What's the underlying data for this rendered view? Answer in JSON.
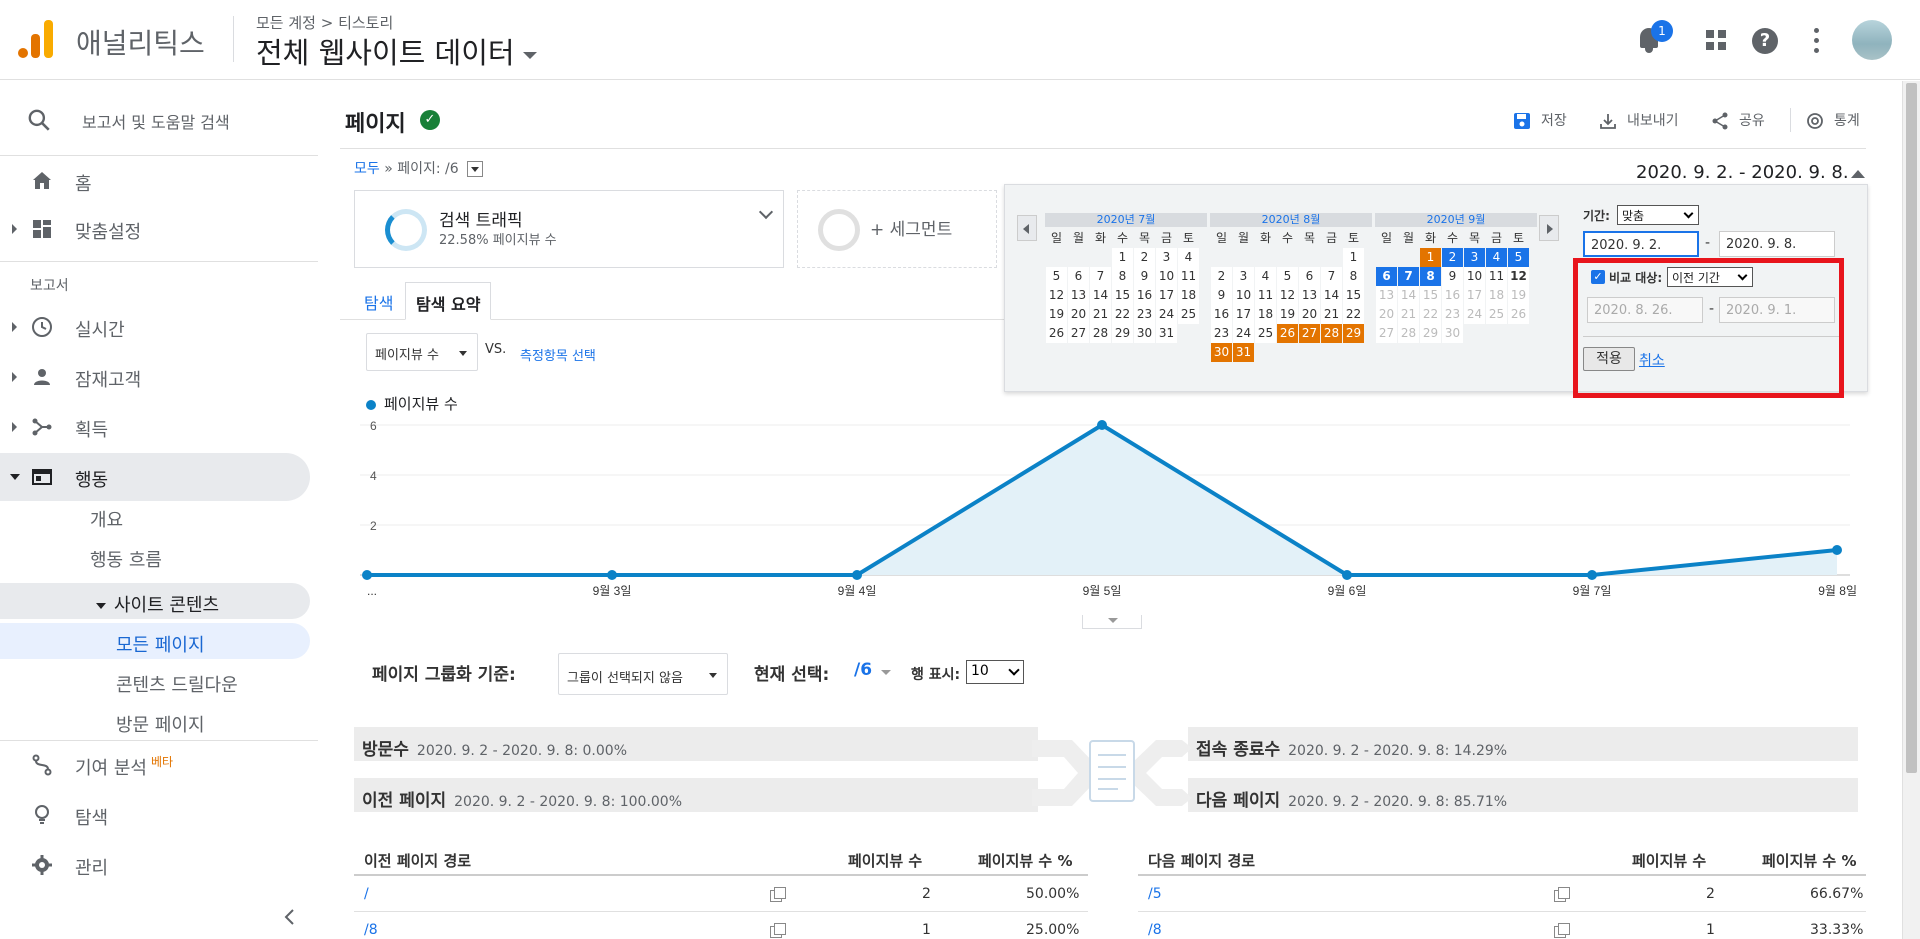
{
  "header": {
    "product_name": "애널리틱스",
    "breadcrumb": "모든 계정 > 티스토리",
    "view_name": "전체 웹사이트 데이터",
    "notification_count": "1",
    "icons": [
      "bell-icon",
      "apps-icon",
      "help-icon",
      "more-vert-icon",
      "avatar"
    ]
  },
  "sidebar": {
    "search_label": "보고서 및 도움말 검색",
    "home": "홈",
    "customization": "맞춤설정",
    "section_reports": "보고서",
    "realtime": "실시간",
    "audience": "잠재고객",
    "acquisition": "획득",
    "behavior": "행동",
    "behavior_sub": {
      "overview": "개요",
      "flow": "행동 흐름",
      "site_content": "사이트 콘텐츠",
      "all_pages": "모든 페이지",
      "drilldown": "콘텐츠 드릴다운",
      "landing": "방문 페이지"
    },
    "attribution": "기여 분석",
    "attribution_badge": "베타",
    "discover": "탐색",
    "admin": "관리"
  },
  "page": {
    "title": "페이지",
    "actions": {
      "save": "저장",
      "export": "내보내기",
      "share": "공유",
      "insights": "통계"
    },
    "crumb_all": "모두",
    "crumb_sep": "»",
    "crumb_page": "페이지: /6",
    "date_range": "2020. 9. 2. - 2020. 9. 8.",
    "segment": {
      "title": "검색 트래픽",
      "subtitle": "22.58% 페이지뷰 수",
      "add": "+ 세그먼트"
    },
    "tabs": {
      "explore": "탐색",
      "summary": "탐색 요약"
    },
    "metric_select": "페이지뷰 수",
    "vs": "VS.",
    "pick_metric": "측정항목 선택",
    "legend": "페이지뷰 수"
  },
  "chart_data": {
    "type": "line",
    "series": [
      {
        "name": "페이지뷰 수",
        "values": [
          0,
          0,
          0,
          6,
          0,
          0,
          1
        ]
      }
    ],
    "x": [
      "...",
      "9월 3일",
      "9월 4일",
      "9월 5일",
      "9월 6일",
      "9월 7일",
      "9월 8일"
    ],
    "yticks": [
      2,
      4,
      6
    ],
    "ylim": [
      0,
      6
    ],
    "color": "#0b82c7",
    "fill": "#e3f1f8",
    "grid": true
  },
  "grouping": {
    "label": "페이지 그룹화 기준:",
    "select": "그룹이 선택되지 않음",
    "current_label": "현재 선택:",
    "current_value": "/6",
    "rows_label": "행 표시:",
    "rows_value": "10"
  },
  "flow": {
    "entrances": {
      "label": "방문수",
      "value": "2020. 9. 2 - 2020. 9. 8: 0.00%"
    },
    "prev_page": {
      "label": "이전 페이지",
      "value": "2020. 9. 2 - 2020. 9. 8: 100.00%"
    },
    "exits": {
      "label": "접속 종료수",
      "value": "2020. 9. 2 - 2020. 9. 8: 14.29%"
    },
    "next_page": {
      "label": "다음 페이지",
      "value": "2020. 9. 2 - 2020. 9. 8: 85.71%"
    }
  },
  "tables": {
    "prev": {
      "headers": [
        "이전 페이지 경로",
        "페이지뷰 수",
        "페이지뷰 수 %"
      ],
      "rows": [
        [
          "/",
          "2",
          "50.00%"
        ],
        [
          "/8",
          "1",
          "25.00%"
        ]
      ]
    },
    "next": {
      "headers": [
        "다음 페이지 경로",
        "페이지뷰 수",
        "페이지뷰 수 %"
      ],
      "rows": [
        [
          "/5",
          "2",
          "66.67%"
        ],
        [
          "/8",
          "1",
          "33.33%"
        ]
      ]
    }
  },
  "date_picker": {
    "weekdays": [
      "일",
      "월",
      "화",
      "수",
      "목",
      "금",
      "토"
    ],
    "months": [
      "2020년 7월",
      "2020년 8월",
      "2020년 9월"
    ],
    "period_label": "기간:",
    "period_value": "맞춤",
    "start_date": "2020. 9. 2.",
    "end_date": "2020. 9. 8.",
    "compare_label": "비교 대상:",
    "compare_value": "이전 기간",
    "compare_start": "2020. 8. 26.",
    "compare_end": "2020. 9. 1.",
    "dash": "-",
    "apply": "적용",
    "cancel": "취소",
    "highlight_color": "#e8141c"
  }
}
